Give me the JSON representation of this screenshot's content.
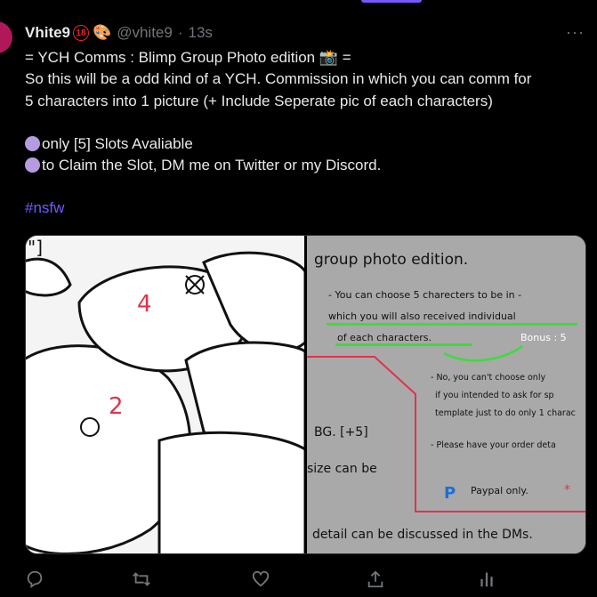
{
  "tweet": {
    "display_name": "Vhite9",
    "badge": "18",
    "emoji": "🎨",
    "handle": "@vhite9",
    "dot": "·",
    "time": "13s",
    "more_label": "···",
    "lines": [
      "= YCH Comms : Blimp Group Photo edition 📸 =",
      " So this will be a odd kind of a YCH. Commission in which you can comm for",
      "5 characters into 1 picture (+ Include Seperate pic of each characters)"
    ],
    "bullets": [
      "only [5] Slots Avaliable",
      "to Claim the Slot, DM me on Twitter or my Discord."
    ],
    "hashtag": "#nsfw"
  },
  "media": {
    "left_fragment": "\"]",
    "number_a": "4",
    "number_b": "2",
    "heading": "group photo edition.",
    "line1": "- You can choose 5 charecters to be in -",
    "line2": "which you will also received individual",
    "line3": "of each characters.",
    "bonus": "Bonus : 5",
    "note1": "- No, you can't choose only",
    "note2": "if you intended to ask for sp",
    "note3": "template just to do only 1 charac",
    "note4": "- Please have your order deta",
    "bg_label": "BG. [+5]",
    "size_label": "size can be",
    "paypal": "Paypal only.",
    "footer": "detail can be discussed in the DMs."
  },
  "colors": {
    "accent": "#7856ff",
    "bullet": "#b59be0",
    "badge": "#f4212e",
    "muted": "#71767b"
  },
  "actions": [
    "reply-icon",
    "retweet-icon",
    "like-icon",
    "share-icon",
    "analytics-icon"
  ]
}
